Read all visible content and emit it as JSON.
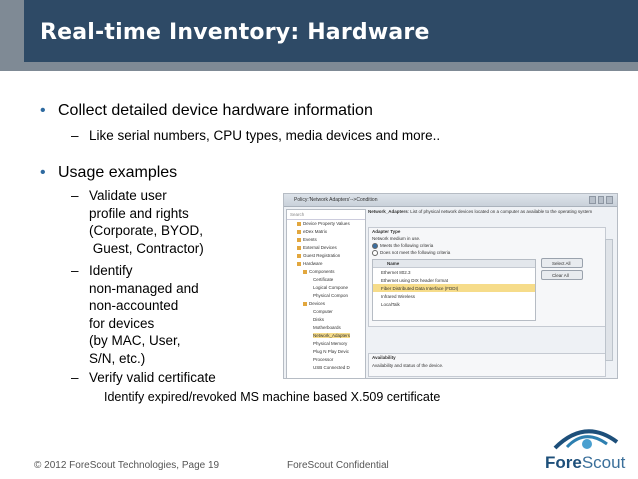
{
  "slide": {
    "title": "Real-time Inventory: Hardware",
    "bullets": [
      {
        "text": "Collect detailed device hardware information",
        "subs": [
          "Like serial numbers, CPU types, media devices and more.."
        ]
      },
      {
        "text": "Usage examples",
        "subs": [
          "Validate user\nprofile and rights\n(Corporate, BYOD,\n Guest, Contractor)",
          "Identify\nnon-managed and\nnon-accounted\nfor devices\n(by MAC, User,\nS/N, etc.)",
          "Verify valid certificate"
        ]
      }
    ],
    "note": "Identify expired/revoked  MS machine based X.509 certificate",
    "accent_color": "#2e4a66",
    "bullet_color": "#2e6aa0"
  },
  "footer": {
    "copyright": "© 2012 ForeScout Technologies, Page 19",
    "confidential": "ForeScout Confidential",
    "logo_a": "Fore",
    "logo_b": "Scout"
  },
  "screenshot": {
    "window_title": "Policy:'Network Adapters'-->Condition",
    "search_placeholder": "Search",
    "tree": [
      "Device Property Values",
      "eDex Matrix",
      "Events",
      "External Devices",
      "Guest Registration",
      "Hardware",
      "Components",
      "Certificate",
      "Logical Compone",
      "Physical Compon",
      "Devices",
      "Computer",
      "Disks",
      "Motherboards",
      "Network_Adapters",
      "Physical Memory",
      "Plug N Play Devic",
      "Processor",
      "USB Connected D"
    ],
    "desc_bold": "Network_Adapters",
    "desc": ": List of physical network devices located on a computer as available to the operating system",
    "panel_title": "Adapter Type",
    "panel_sub": "Network medium in use.",
    "radio_meets": "Meets the following criteria",
    "radio_not": "Does not meet the following criteria",
    "list_header": "Name",
    "list_rows": [
      "Ethernet 802.3",
      "Ethernet using DIX header format",
      "Fiber Distributed Data Interface (FDDI)",
      "Infrared Wireless",
      "LocalTalk"
    ],
    "select_all": "Select All",
    "clear_all": "Clear All",
    "availability_title": "Availability",
    "availability_desc": "Availability and status of the device."
  }
}
